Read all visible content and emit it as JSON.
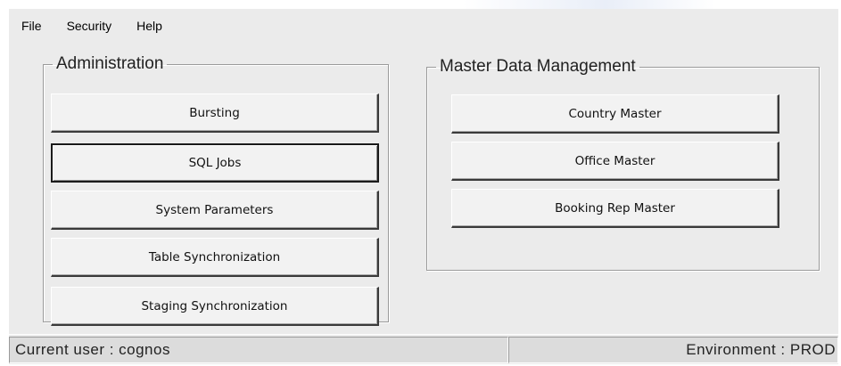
{
  "menu": {
    "items": [
      "File",
      "Security",
      "Help"
    ]
  },
  "administration": {
    "title": "Administration",
    "buttons": [
      "Bursting",
      "SQL Jobs",
      "System Parameters",
      "Table Synchronization",
      "Staging Synchronization"
    ]
  },
  "master_data": {
    "title": "Master Data Management",
    "buttons": [
      "Country Master",
      "Office Master",
      "Booking Rep Master"
    ]
  },
  "status": {
    "user": "Current user : cognos",
    "environment": "Environment : PROD"
  },
  "colors": {
    "window_bg": "#ebebeb",
    "status_bg": "#dcdcdc",
    "button_face": "#f2f2f2"
  },
  "focused_button": "SQL Jobs"
}
